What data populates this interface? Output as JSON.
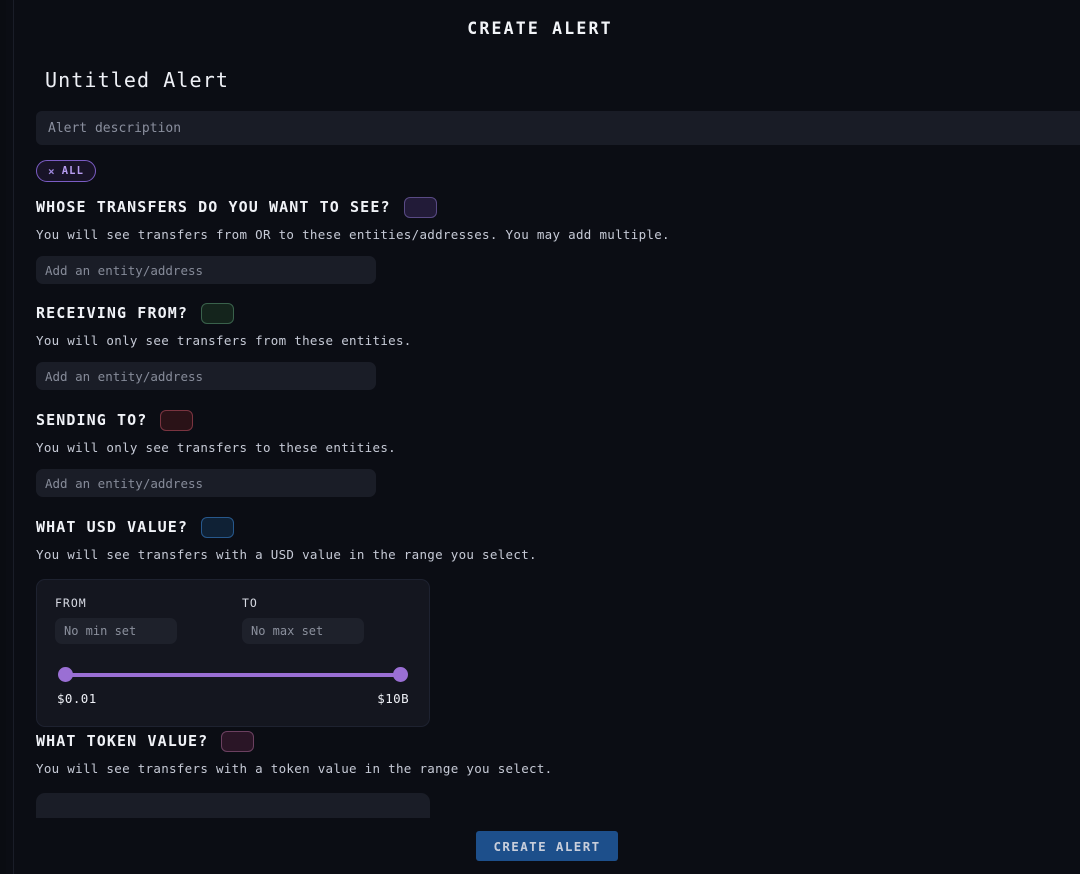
{
  "window": {
    "title": "CREATE ALERT"
  },
  "alert": {
    "name": "Untitled Alert",
    "description_value": "",
    "description_placeholder": "Alert description"
  },
  "filter_chips": [
    {
      "label": "ALL",
      "remove_icon": "×"
    }
  ],
  "sections": [
    {
      "id": "whose-transfers",
      "heading": "WHOSE TRANSFERS DO YOU WANT TO SEE?",
      "tag_color": "#594a85",
      "description": "You will see transfers from OR to these entities/addresses. You may add multiple.",
      "input_value": "",
      "input_placeholder": "Add an entity/address"
    },
    {
      "id": "receiving-from",
      "heading": "RECEIVING FROM?",
      "tag_color": "#39614b",
      "description": "You will only see transfers from these entities.",
      "input_value": "",
      "input_placeholder": "Add an entity/address"
    },
    {
      "id": "sending-to",
      "heading": "SENDING TO?",
      "tag_color": "#7a3440",
      "description": "You will only see transfers to these entities.",
      "input_value": "",
      "input_placeholder": "Add an entity/address"
    },
    {
      "id": "usd-value",
      "heading": "WHAT USD VALUE?",
      "tag_color": "#27588c",
      "description": "You will see transfers with a USD value in the range you select."
    },
    {
      "id": "token-value",
      "heading": "WHAT TOKEN VALUE?",
      "tag_color": "#6b4060",
      "description": "You will see transfers with a token value in the range you select."
    }
  ],
  "usd_range": {
    "from_label": "FROM",
    "to_label": "TO",
    "from_value": "",
    "from_placeholder": "No min set",
    "to_value": "",
    "to_placeholder": "No max set",
    "scale_min": "$0.01",
    "scale_max": "$10B",
    "slider_accent": "#9a6fd4"
  },
  "footer": {
    "submit_label": "CREATE ALERT",
    "submit_color": "#1d4f8b"
  }
}
